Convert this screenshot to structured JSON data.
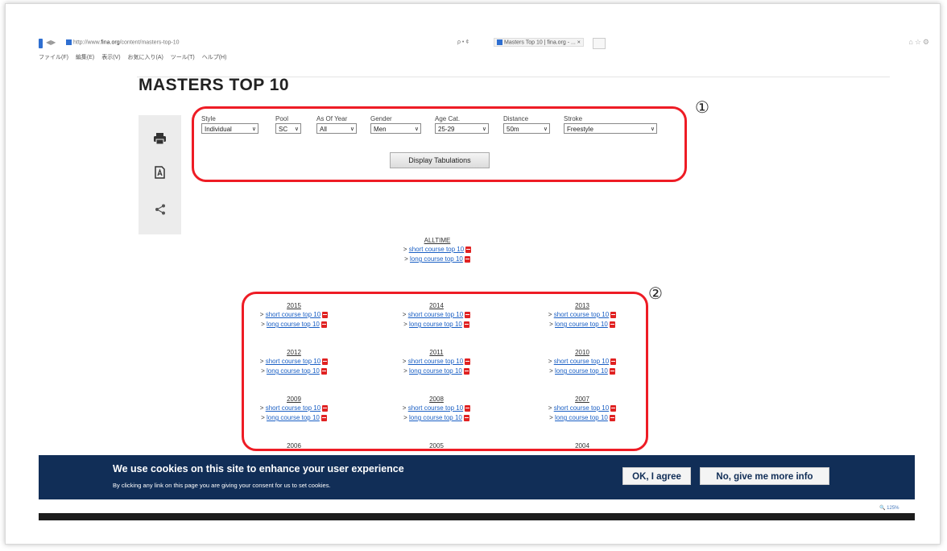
{
  "browser": {
    "url_prefix": "http://www.",
    "url_domain": "fina.org",
    "url_path": "/content/masters-top-10",
    "search_controls": "ρ • ¢",
    "tab_title": "Masters Top 10 | fina.org - ...",
    "menu": [
      "ファイル(F)",
      "編集(E)",
      "表示(V)",
      "お気に入り(A)",
      "ツール(T)",
      "ヘルプ(H)"
    ],
    "zoom_text": "125%"
  },
  "page": {
    "title": "MASTERS TOP 10"
  },
  "filters": {
    "style": {
      "label": "Style",
      "value": "Individual"
    },
    "pool": {
      "label": "Pool",
      "value": "SC"
    },
    "year": {
      "label": "As Of Year",
      "value": "All"
    },
    "gender": {
      "label": "Gender",
      "value": "Men"
    },
    "age": {
      "label": "Age Cat.",
      "value": "25-29"
    },
    "distance": {
      "label": "Distance",
      "value": "50m"
    },
    "stroke": {
      "label": "Stroke",
      "value": "Freestyle"
    },
    "button_label": "Display Tabulations"
  },
  "annotations": {
    "marker1": "①",
    "marker2": "②",
    "color": "#ee1c25"
  },
  "links": {
    "prefix": ">",
    "short": "short course top 10",
    "long": "long course top 10",
    "alltime": "ALLTIME"
  },
  "years": [
    "2015",
    "2014",
    "2013",
    "2012",
    "2011",
    "2010",
    "2009",
    "2008",
    "2007",
    "2006",
    "2005",
    "2004"
  ],
  "cookie": {
    "heading": "We use cookies on this site to enhance your user experience",
    "text": "By clicking any link on this page you are giving your consent for us to set cookies.",
    "agree": "OK, I agree",
    "more": "No, give me more info",
    "bg": "#112e57"
  },
  "icons": {
    "print": "print-icon",
    "pdf": "pdf-icon",
    "share": "share-icon"
  }
}
